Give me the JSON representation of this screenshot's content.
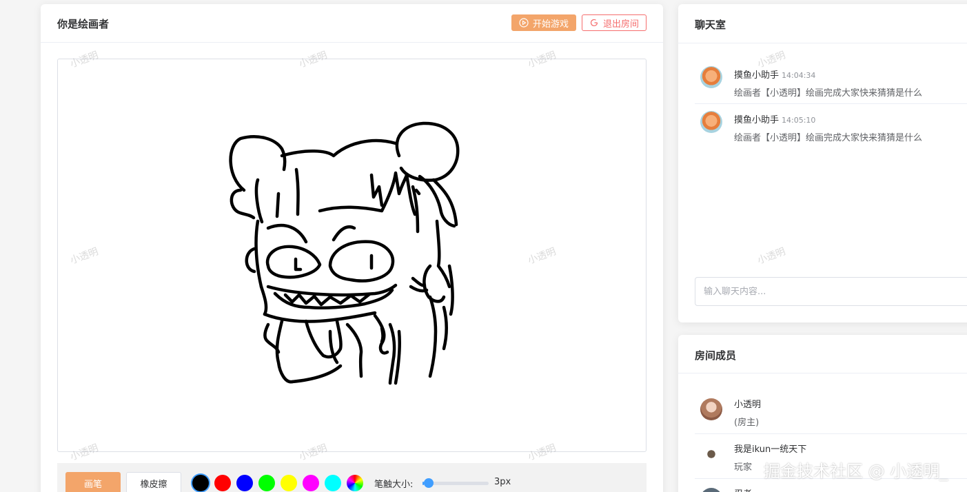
{
  "draw_panel": {
    "title": "你是绘画者",
    "start_button": "开始游戏",
    "exit_button": "退出房间",
    "toolbar": {
      "pen_button": "画笔",
      "eraser_button": "橡皮擦",
      "colors": [
        "#000000",
        "#ff0000",
        "#0000ff",
        "#00ff00",
        "#ffff00",
        "#ff00ff",
        "#00ffff"
      ],
      "selected_color": "#000000",
      "custom_color_icon": "color-wheel-icon",
      "size_label": "笔触大小:",
      "brush_size_min": 1,
      "brush_size_max": 100,
      "brush_size": 3,
      "size_value": "3px"
    }
  },
  "chat": {
    "title": "聊天室",
    "messages": [
      {
        "name": "摸鱼小助手",
        "time": "14:04:34",
        "text": "绘画者【小透明】绘画完成大家快来猜猜是什么"
      },
      {
        "name": "摸鱼小助手",
        "time": "14:05:10",
        "text": "绘画者【小透明】绘画完成大家快来猜猜是什么"
      }
    ],
    "input_placeholder": "输入聊天内容..."
  },
  "members": {
    "title": "房间成员",
    "list": [
      {
        "name": "小透明",
        "role": "(房主)"
      },
      {
        "name": "我是ikun一统天下",
        "role": "玩家"
      },
      {
        "name": "忍者",
        "role": ""
      }
    ]
  },
  "watermark": "小透明",
  "site_watermark": "掘金技术社区 @ 小透明_"
}
